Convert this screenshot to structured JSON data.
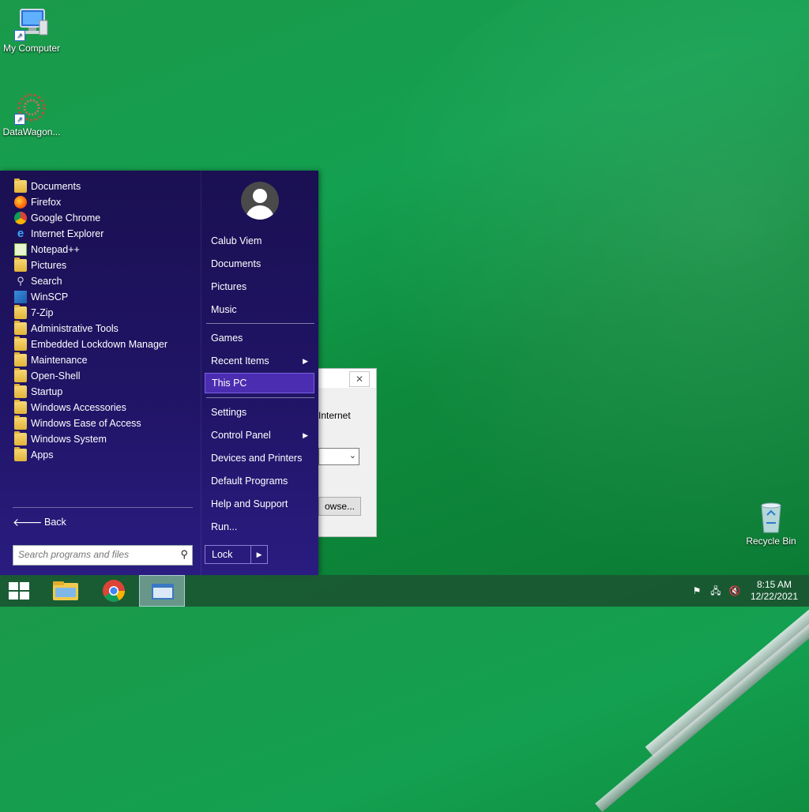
{
  "desktop": {
    "icons": [
      {
        "label": "My Computer",
        "icon": "computer-icon"
      },
      {
        "label": "DataWagon...",
        "icon": "datawagon-icon"
      },
      {
        "label": "Recycle Bin",
        "icon": "recycle-bin-icon"
      }
    ]
  },
  "dialog": {
    "text": "Internet",
    "browse_label": "owse...",
    "close_glyph": "✕"
  },
  "start_menu": {
    "programs": [
      {
        "label": "Documents",
        "icon": "folder-icon"
      },
      {
        "label": "Firefox",
        "icon": "firefox-icon"
      },
      {
        "label": "Google Chrome",
        "icon": "chrome-icon"
      },
      {
        "label": "Internet Explorer",
        "icon": "ie-icon"
      },
      {
        "label": "Notepad++",
        "icon": "notepadpp-icon"
      },
      {
        "label": "Pictures",
        "icon": "pictures-icon"
      },
      {
        "label": "Search",
        "icon": "search-icon"
      },
      {
        "label": "WinSCP",
        "icon": "winscp-icon"
      },
      {
        "label": "7-Zip",
        "icon": "folder-icon"
      },
      {
        "label": "Administrative Tools",
        "icon": "folder-icon"
      },
      {
        "label": "Embedded Lockdown Manager",
        "icon": "folder-icon"
      },
      {
        "label": "Maintenance",
        "icon": "folder-icon"
      },
      {
        "label": "Open-Shell",
        "icon": "folder-icon"
      },
      {
        "label": "Startup",
        "icon": "folder-icon"
      },
      {
        "label": "Windows Accessories",
        "icon": "folder-icon"
      },
      {
        "label": "Windows Ease of Access",
        "icon": "folder-icon"
      },
      {
        "label": "Windows System",
        "icon": "folder-icon"
      },
      {
        "label": "Apps",
        "icon": "apps-icon"
      }
    ],
    "back_label": "Back",
    "search_placeholder": "Search programs and files",
    "user_name": "Calub Viem",
    "right_items": {
      "documents": "Documents",
      "pictures": "Pictures",
      "music": "Music",
      "games": "Games",
      "recent_items": "Recent Items",
      "this_pc": "This PC",
      "settings": "Settings",
      "control_panel": "Control Panel",
      "devices_printers": "Devices and Printers",
      "default_programs": "Default Programs",
      "help_support": "Help and Support",
      "run": "Run..."
    },
    "lock_label": "Lock",
    "submenu_glyph": "▶"
  },
  "taskbar": {
    "clock_time": "8:15 AM",
    "clock_date": "12/22/2021"
  }
}
